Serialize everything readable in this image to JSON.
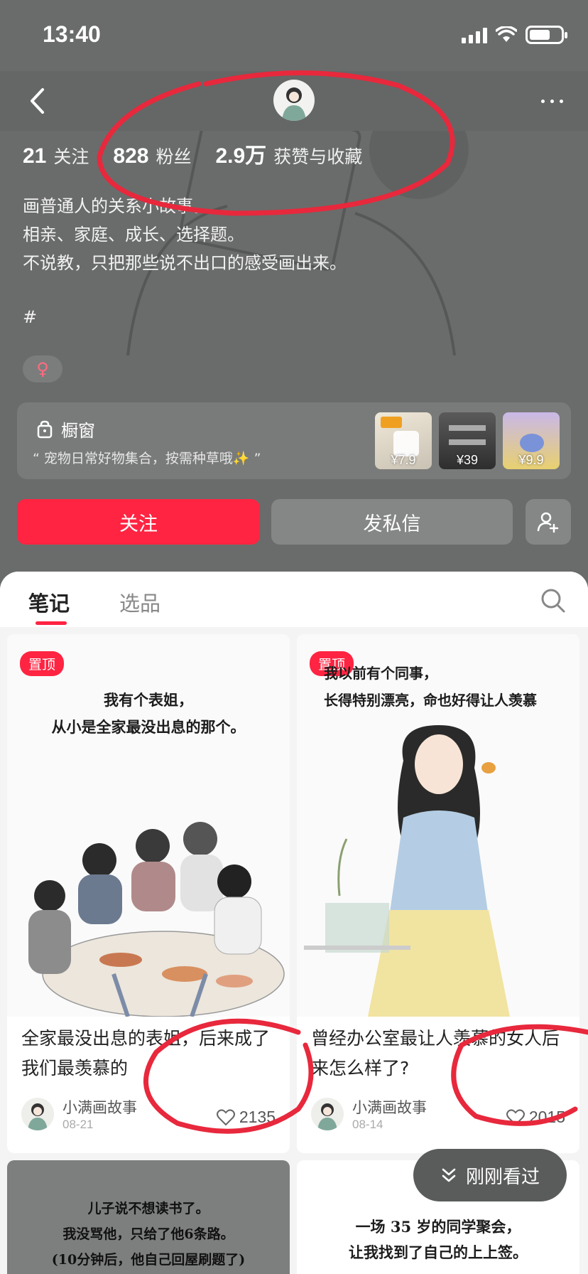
{
  "status_bar": {
    "time": "13:40"
  },
  "profile": {
    "stats": [
      {
        "num": "21",
        "label": "关注"
      },
      {
        "num": "828",
        "label": "粉丝"
      },
      {
        "num": "2.9万",
        "label": "获赞与收藏"
      }
    ],
    "bio_lines": [
      "画普通人的关系小故事。",
      "相亲、家庭、成长、选择题。",
      "不说教，只把那些说不出口的感受画出来。"
    ],
    "hashtag": "#",
    "gender_symbol": "♀"
  },
  "shop": {
    "title": "橱窗",
    "description": "“ 宠物日常好物集合，按需种草哦✨ ”",
    "items": [
      {
        "price": "¥7.9",
        "icon": "product-thumb-white-bag"
      },
      {
        "price": "¥39",
        "icon": "product-thumb-rack"
      },
      {
        "price": "¥9.9",
        "icon": "product-thumb-toy"
      }
    ]
  },
  "actions": {
    "follow": "关注",
    "message": "发私信"
  },
  "tabs": {
    "notes": "笔记",
    "products": "选品"
  },
  "notes": [
    {
      "pin": "置顶",
      "cover_lines": [
        "我有个表姐，",
        "从小是全家最没出息的那个。"
      ],
      "title": "全家最没出息的表姐，后来成了我们最羡慕的",
      "author": "小满画故事",
      "date": "08-21",
      "likes": "2135"
    },
    {
      "pin": "置顶",
      "cover_lines": [
        "我以前有个同事，",
        "长得特别漂亮，命也好得让人羡慕"
      ],
      "title": "曾经办公室最让人羡慕的女人后来怎么样了?",
      "author": "小满画故事",
      "date": "08-14",
      "likes": "2015"
    },
    {
      "cover_lines": [
        "儿子说不想读书了。",
        "我没骂他，只给了他6条路。",
        "(10分钟后，他自己回屋刷题了)"
      ]
    },
    {
      "cover_lines": [
        "一场 35 岁的同学聚会，",
        "让我找到了自己的上上签。"
      ]
    }
  ],
  "recent_button": "刚刚看过",
  "colors": {
    "accent": "#ff2442",
    "annotation": "#e8283c"
  }
}
